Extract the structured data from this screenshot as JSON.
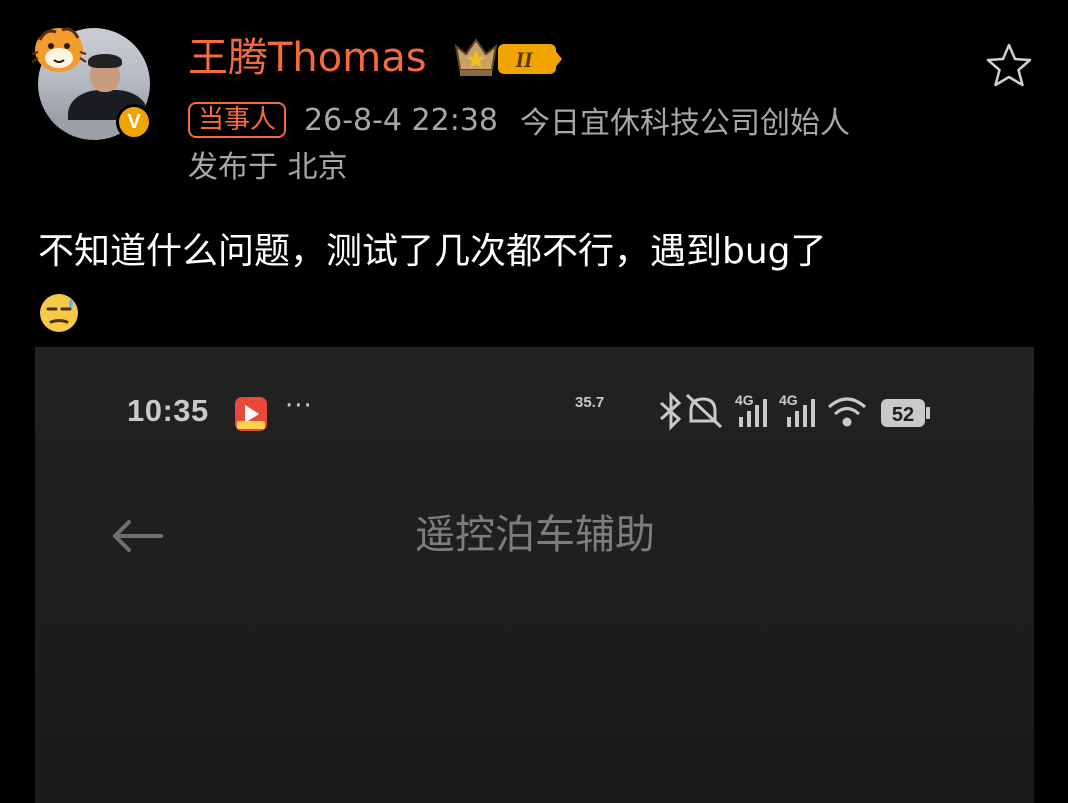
{
  "post": {
    "username": "王腾Thomas",
    "level_badge": "II",
    "role_tag": "当事人",
    "timestamp": "26-8-4 22:38",
    "author_title": "今日宜休科技公司创始人",
    "location": "发布于 北京",
    "verified_mark": "V",
    "text": "不知道什么问题，测试了几次都不行，遇到bug了",
    "emoji": "sweat-face-icon"
  },
  "embedded_screenshot": {
    "status_bar": {
      "time": "10:35",
      "more": "···",
      "net_speed": "35.7",
      "signal_1": "4G",
      "signal_2": "4G",
      "battery": "52"
    },
    "nav": {
      "title": "遥控泊车辅助"
    }
  },
  "colors": {
    "username": "#f56a3c",
    "meta": "#a6a6a6",
    "background": "#000000",
    "verified": "#f0a400"
  }
}
